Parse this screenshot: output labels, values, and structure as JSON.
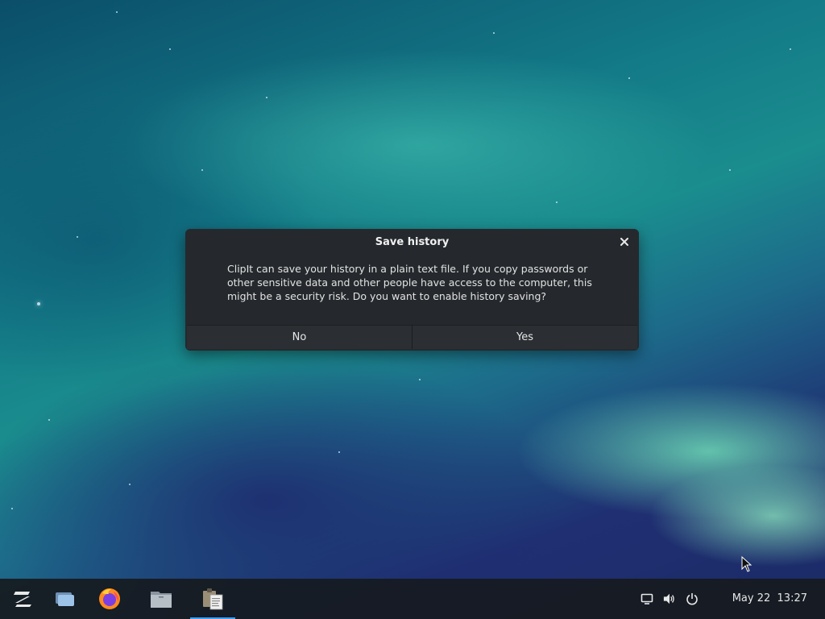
{
  "dialog": {
    "title": "Save history",
    "message": "ClipIt can save your history in a plain text file. If you copy passwords or other sensitive data and other people have access to the computer, this might be a security risk. Do you want to enable history saving?",
    "buttons": {
      "no": "No",
      "yes": "Yes"
    },
    "close_icon": "close-icon"
  },
  "taskbar": {
    "items": [
      {
        "icon": "zorin-menu-icon"
      },
      {
        "icon": "workspaces-icon"
      },
      {
        "icon": "firefox-icon"
      },
      {
        "icon": "files-icon"
      },
      {
        "icon": "clipit-icon",
        "active": true
      }
    ],
    "tray": [
      "screen-icon",
      "volume-icon",
      "power-icon"
    ],
    "date": "May 22",
    "time": "13:27"
  },
  "colors": {
    "dialog_bg": "#25292d",
    "taskbar_bg": "#161a1e",
    "accent": "#3aa0ff"
  }
}
